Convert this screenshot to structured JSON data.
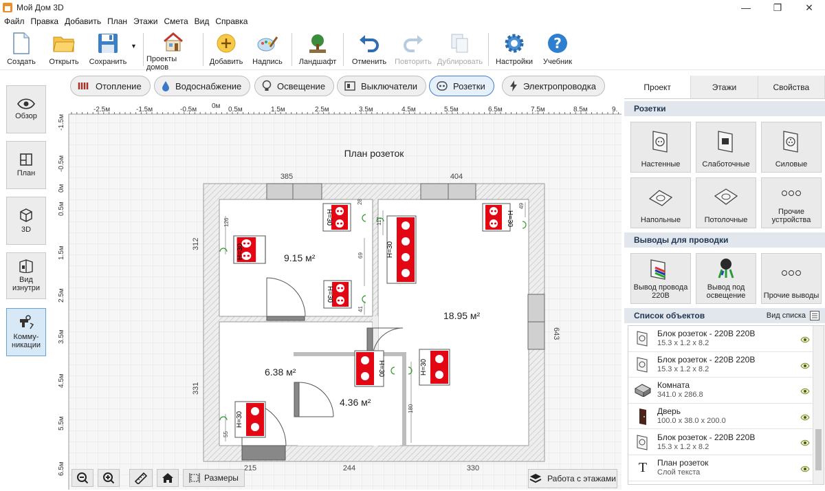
{
  "app": {
    "title": "Мой Дом 3D"
  },
  "menu": [
    "Файл",
    "Правка",
    "Добавить",
    "План",
    "Этажи",
    "Смета",
    "Вид",
    "Справка"
  ],
  "toolbar": {
    "create": "Создать",
    "open": "Открыть",
    "save": "Сохранить",
    "projects": "Проекты домов",
    "add": "Добавить",
    "label": "Надпись",
    "landscape": "Ландшафт",
    "undo": "Отменить",
    "redo": "Повторить",
    "duplicate": "Дублировать",
    "settings": "Настройки",
    "tutorial": "Учебник"
  },
  "left_rail": {
    "overview": "Обзор",
    "plan": "План",
    "view3d": "3D",
    "inside1": "Вид",
    "inside2": "изнутри",
    "comm1": "Комму-",
    "comm2": "никации"
  },
  "categories": {
    "heating": "Отопление",
    "water": "Водоснабжение",
    "lighting": "Освещение",
    "switches": "Выключатели",
    "sockets": "Розетки",
    "wiring": "Электропроводка"
  },
  "plan": {
    "title": "План розеток",
    "ruler_top": [
      "-2.5м",
      "-1.5м",
      "-0.5м",
      "0м",
      "0.5м",
      "1.5м",
      "2.5м",
      "3.5м",
      "4.5м",
      "5.5м",
      "6.5м",
      "7.5м",
      "8.5м",
      "9."
    ],
    "ruler_left": [
      "-1.5м",
      "-0.5м",
      "0м",
      "0.5м",
      "1.5м",
      "2.5м",
      "3.5м",
      "4.5м",
      "5.5м",
      "6.5м"
    ],
    "dims": {
      "top1": "385",
      "top2": "404",
      "left1": "312",
      "left2": "331",
      "right": "643",
      "bottom1": "215",
      "bottom2": "244",
      "bottom3": "330",
      "w126": "126",
      "w69": "69",
      "w41": "41",
      "w117": "117",
      "w28": "28",
      "w49": "49",
      "w180": "180",
      "w55": "55",
      "w19": "19"
    },
    "areas": {
      "r1": "9.15 м²",
      "r2": "18.95 м²",
      "r3": "6.38 м²",
      "r4": "4.36 м²"
    },
    "socket_height": "H=30"
  },
  "bottom": {
    "sizes": "Размеры",
    "floors": "Работа с этажами"
  },
  "right_panel": {
    "tabs": [
      "Проект",
      "Этажи",
      "Свойства"
    ],
    "sockets_header": "Розетки",
    "sockets": [
      "Настенные",
      "Слаботочные",
      "Силовые",
      "Напольные",
      "Потолочные",
      "Прочие устройства"
    ],
    "outlets_header": "Выводы для проводки",
    "outlets": [
      "Вывод провода 220В",
      "Вывод под освещение",
      "Прочие выводы"
    ],
    "list_header": "Список объектов",
    "list_view": "Вид списка",
    "objects": [
      {
        "name": "Блок розеток - 220В 220В",
        "dims": "15.3 x 1.2 x 8.2"
      },
      {
        "name": "Блок розеток - 220В 220В",
        "dims": "15.3 x 1.2 x 8.2"
      },
      {
        "name": "Комната",
        "dims": "341.0 x 286.8"
      },
      {
        "name": "Дверь",
        "dims": "100.0 x 38.0 x 200.0"
      },
      {
        "name": "Блок розеток - 220В 220В",
        "dims": "15.3 x 1.2 x 8.2"
      },
      {
        "name": "План розеток",
        "dims": "Слой текста"
      }
    ]
  },
  "colors": {
    "accent": "#3f7fc4",
    "socket": "#e30613",
    "wall": "#d9d9d9"
  }
}
